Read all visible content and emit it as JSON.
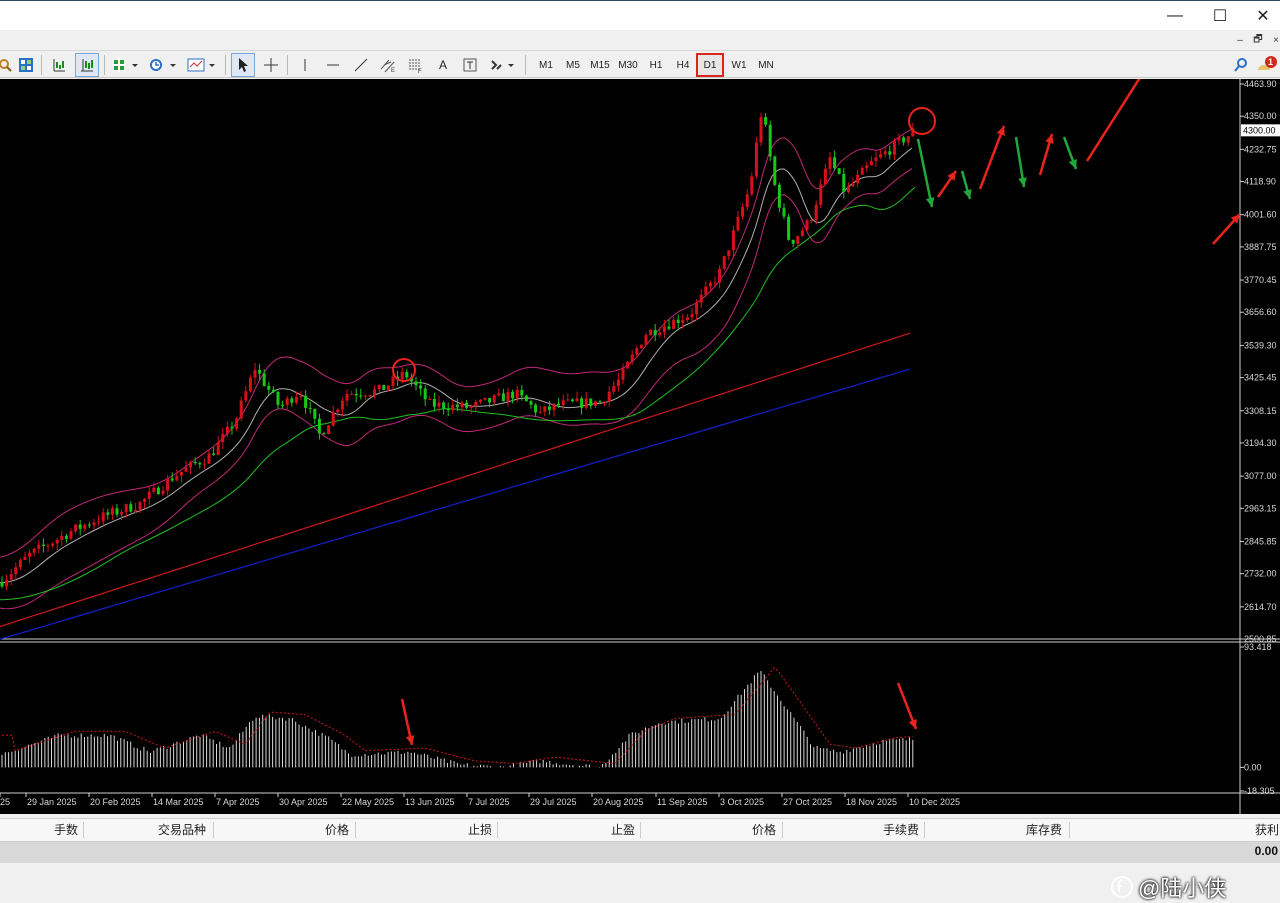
{
  "window": {
    "minimize_glyph": "—",
    "maximize_glyph": "☐",
    "close_glyph": "✕"
  },
  "mdi": {
    "minimize_glyph": "–",
    "restore_glyph": "🗗",
    "close_glyph": "×"
  },
  "toolbar": {
    "timeframes": [
      "M1",
      "M5",
      "M15",
      "M30",
      "H1",
      "H4",
      "D1",
      "W1",
      "MN"
    ],
    "active_timeframe": "D1",
    "text_tool_label": "A",
    "notification_count": "1",
    "accent_color": "#d9261c"
  },
  "chart": {
    "price_axis": [
      "4463.90",
      "4350.00",
      "4300.00",
      "4232.75",
      "4118.90",
      "4001.60",
      "3887.75",
      "3770.45",
      "3656.60",
      "3539.30",
      "3425.45",
      "3308.15",
      "3194.30",
      "3077.00",
      "2963.15",
      "2845.85",
      "2732.00",
      "2614.70",
      "2500.85"
    ],
    "current_price": "4300.00",
    "indicator_axis": [
      "93.418",
      "0.00",
      "-18.305"
    ],
    "date_axis": [
      "25",
      "29 Jan 2025",
      "20 Feb 2025",
      "14 Mar 2025",
      "7 Apr 2025",
      "30 Apr 2025",
      "22 May 2025",
      "13 Jun 2025",
      "7 Jul 2025",
      "29 Jul 2025",
      "20 Aug 2025",
      "11 Sep 2025",
      "3 Oct 2025",
      "27 Oct 2025",
      "18 Nov 2025",
      "10 Dec 2025"
    ],
    "colors": {
      "background": "#000000",
      "bull_candle": "#d8101a",
      "bear_candle": "#18c818",
      "bollinger": "#c02878",
      "ma_short": "#b0b0b0",
      "ma_green": "#20c020",
      "ma_red": "#d01818",
      "ma_blue": "#1020d0",
      "annotation_red": "#e8241c",
      "annotation_green": "#20a83a"
    }
  },
  "terminal": {
    "columns": [
      "手数",
      "交易品种",
      "价格",
      "止损",
      "止盈",
      "价格",
      "手续费",
      "库存费",
      "获利"
    ],
    "total": "0.00"
  },
  "watermark": {
    "text": "@陆小侠"
  }
}
